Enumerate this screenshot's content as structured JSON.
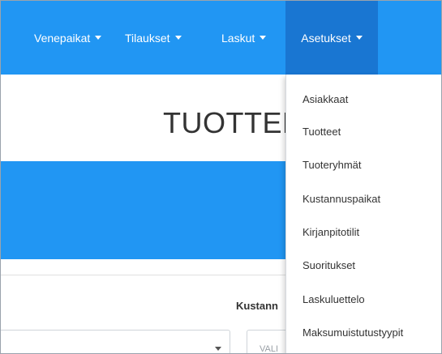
{
  "navbar": {
    "items": [
      {
        "label": "Venepaikat"
      },
      {
        "label": "Tilaukset"
      },
      {
        "label": "Laskut"
      },
      {
        "label": "Asetukset"
      }
    ]
  },
  "page": {
    "title": "TUOTTEET"
  },
  "filters": {
    "label": "Kustann",
    "second_select_placeholder": "VALI"
  },
  "dropdown": {
    "items": [
      {
        "label": "Asiakkaat"
      },
      {
        "label": "Tuotteet"
      },
      {
        "label": "Tuoteryhmät"
      },
      {
        "label": "Kustannuspaikat"
      },
      {
        "label": "Kirjanpitotilit"
      },
      {
        "label": "Suoritukset"
      },
      {
        "label": "Laskuluettelo"
      },
      {
        "label": "Maksumuistutustyypit"
      }
    ]
  },
  "colors": {
    "navbar": "#2196f3",
    "navbar_active": "#1976d2",
    "band": "#2196f3"
  }
}
